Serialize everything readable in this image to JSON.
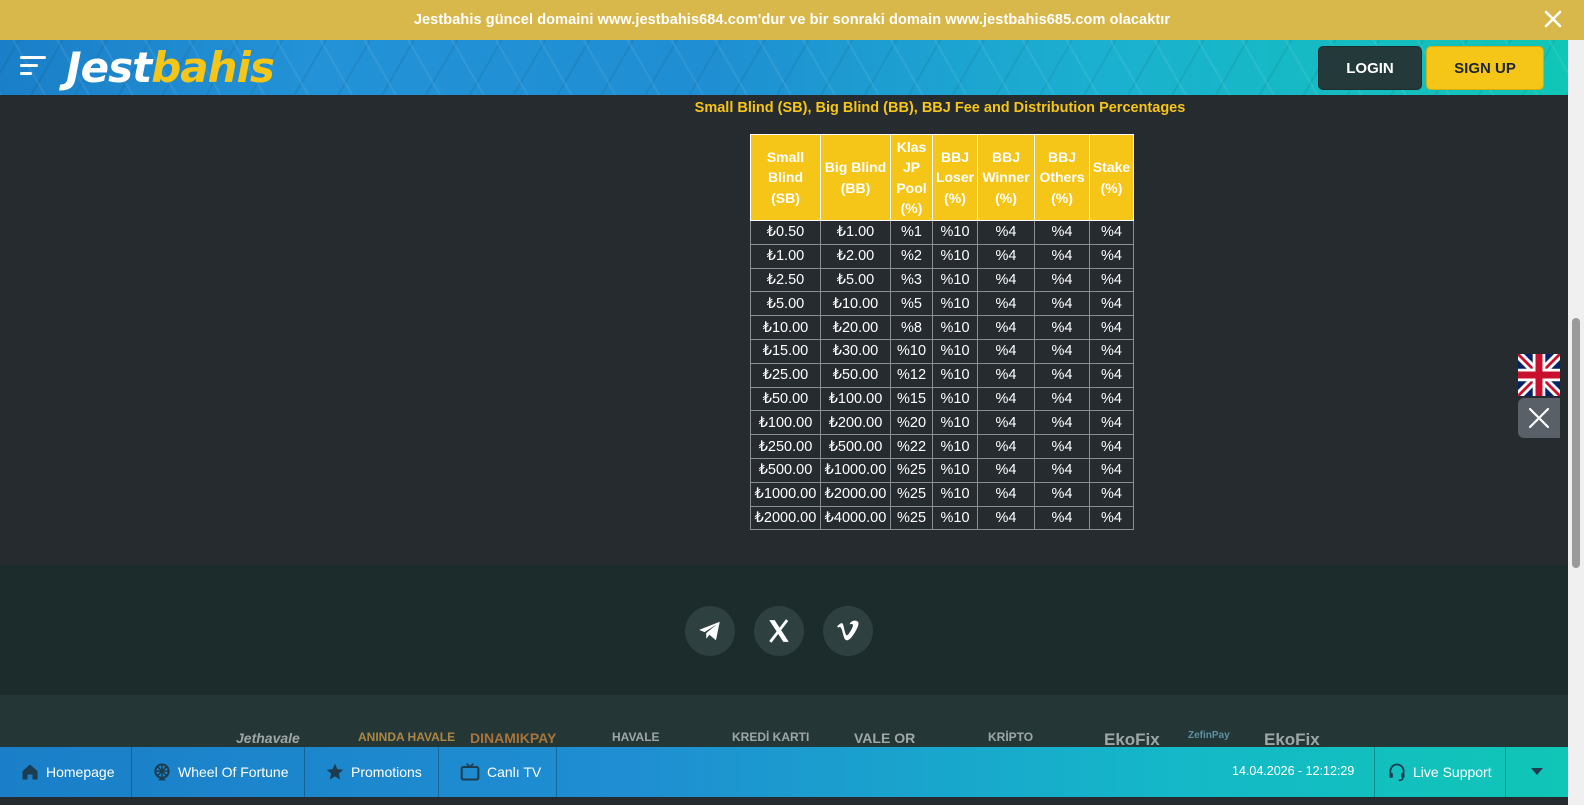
{
  "announcement": {
    "text": "Jestbahis güncel domaini www.jestbahis684.com'dur ve bir sonraki domain www.jestbahis685.com olacaktır",
    "close_icon": "close-icon"
  },
  "header": {
    "logo_part1": "Jest",
    "logo_part2": "bahis",
    "login_label": "LOGIN",
    "signup_label": "SIGN UP"
  },
  "colors": {
    "accent_yellow": "#f5c518",
    "header_blue": "#1f8ed2",
    "header_teal": "#10c6b6",
    "page_bg": "#262b30",
    "footer_bg": "#1c2b2b"
  },
  "content": {
    "section_title": "Small Blind (SB), Big Blind (BB), BBJ Fee and Distribution Percentages",
    "table": {
      "headers": [
        "Small Blind (SB)",
        "Big Blind (BB)",
        "Klas JP Pool (%)",
        "BBJ Loser (%)",
        "BBJ Winner (%)",
        "BBJ Others (%)",
        "Stake (%)"
      ],
      "rows": [
        [
          "₺0.50",
          "₺1.00",
          "%1",
          "%10",
          "%4",
          "%4",
          "%4"
        ],
        [
          "₺1.00",
          "₺2.00",
          "%2",
          "%10",
          "%4",
          "%4",
          "%4"
        ],
        [
          "₺2.50",
          "₺5.00",
          "%3",
          "%10",
          "%4",
          "%4",
          "%4"
        ],
        [
          "₺5.00",
          "₺10.00",
          "%5",
          "%10",
          "%4",
          "%4",
          "%4"
        ],
        [
          "₺10.00",
          "₺20.00",
          "%8",
          "%10",
          "%4",
          "%4",
          "%4"
        ],
        [
          "₺15.00",
          "₺30.00",
          "%10",
          "%10",
          "%4",
          "%4",
          "%4"
        ],
        [
          "₺25.00",
          "₺50.00",
          "%12",
          "%10",
          "%4",
          "%4",
          "%4"
        ],
        [
          "₺50.00",
          "₺100.00",
          "%15",
          "%10",
          "%4",
          "%4",
          "%4"
        ],
        [
          "₺100.00",
          "₺200.00",
          "%20",
          "%10",
          "%4",
          "%4",
          "%4"
        ],
        [
          "₺250.00",
          "₺500.00",
          "%22",
          "%10",
          "%4",
          "%4",
          "%4"
        ],
        [
          "₺500.00",
          "₺1000.00",
          "%25",
          "%10",
          "%4",
          "%4",
          "%4"
        ],
        [
          "₺1000.00",
          "₺2000.00",
          "%25",
          "%10",
          "%4",
          "%4",
          "%4"
        ],
        [
          "₺2000.00",
          "₺4000.00",
          "%25",
          "%10",
          "%4",
          "%4",
          "%4"
        ]
      ]
    }
  },
  "side": {
    "language_icon": "uk-flag-icon",
    "close_icon": "close-icon"
  },
  "footer": {
    "social": [
      "telegram-icon",
      "x-icon",
      "vimeo-icon"
    ],
    "payment_logos": [
      "Jethavale",
      "ANINDA HAVALE",
      "DINAMIKPAY",
      "HAVALE",
      "KREDİ KARTI",
      "VALE OR",
      "KRİPTO",
      "EkoFix",
      "ZefinPay",
      "EkoFix"
    ]
  },
  "bottom_nav": {
    "items": [
      {
        "label": "Homepage",
        "icon": "home-icon"
      },
      {
        "label": "Wheel Of Fortune",
        "icon": "wheel-icon"
      },
      {
        "label": "Promotions",
        "icon": "star-icon"
      },
      {
        "label": "Canlı TV",
        "icon": "tv-icon"
      }
    ],
    "datetime": "14.04.2026 - 12:12:29",
    "support_label": "Live Support",
    "toggle_icon": "caret-down-icon"
  }
}
